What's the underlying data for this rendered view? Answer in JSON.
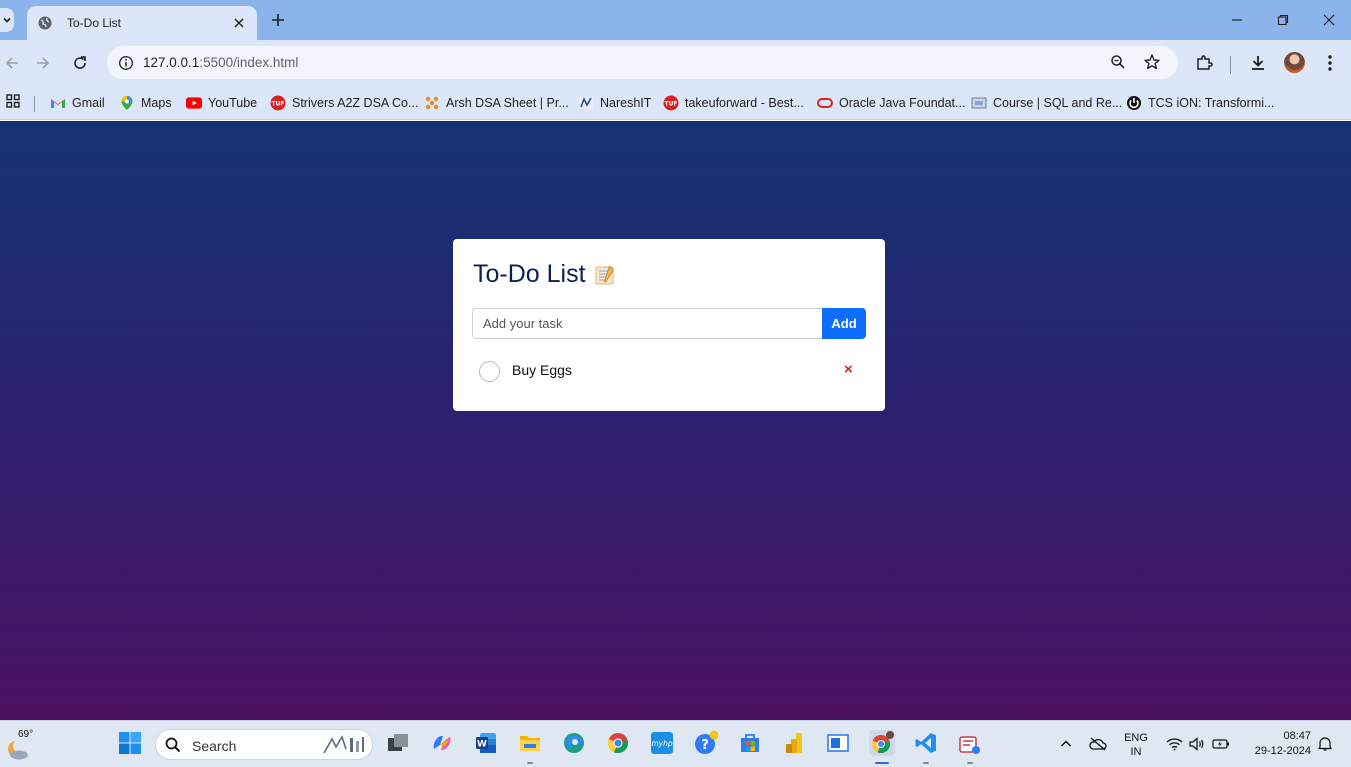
{
  "browser": {
    "tab": {
      "title": "To-Do List",
      "icon": "globe-icon"
    },
    "address": {
      "host": "127.0.0.1",
      "rest": ":5500/index.html"
    },
    "bookmarks": [
      {
        "label": "Gmail",
        "icon": "gmail-icon"
      },
      {
        "label": "Maps",
        "icon": "maps-icon"
      },
      {
        "label": "YouTube",
        "icon": "youtube-icon"
      },
      {
        "label": "Strivers A2Z DSA Co...",
        "icon": "tuf-icon"
      },
      {
        "label": "Arsh DSA Sheet | Pr...",
        "icon": "arsh-icon"
      },
      {
        "label": "NareshIT",
        "icon": "nareshit-icon"
      },
      {
        "label": "takeuforward - Best...",
        "icon": "tuf-icon"
      },
      {
        "label": "Oracle Java Foundat...",
        "icon": "oracle-icon"
      },
      {
        "label": "Course | SQL and Re...",
        "icon": "course-icon"
      },
      {
        "label": "TCS iON: Transformi...",
        "icon": "tcs-icon"
      }
    ]
  },
  "app": {
    "title": "To-Do List",
    "title_icon": "notepad-icon",
    "input": {
      "placeholder": "Add your task",
      "value": ""
    },
    "add_label": "Add",
    "tasks": [
      {
        "label": "Buy Eggs",
        "done": false,
        "delete_label": "×"
      }
    ]
  },
  "taskbar": {
    "weather_temp": "69°",
    "search_label": "Search",
    "lang_top": "ENG",
    "lang_bottom": "IN",
    "time": "08:47",
    "date": "29-12-2024"
  }
}
